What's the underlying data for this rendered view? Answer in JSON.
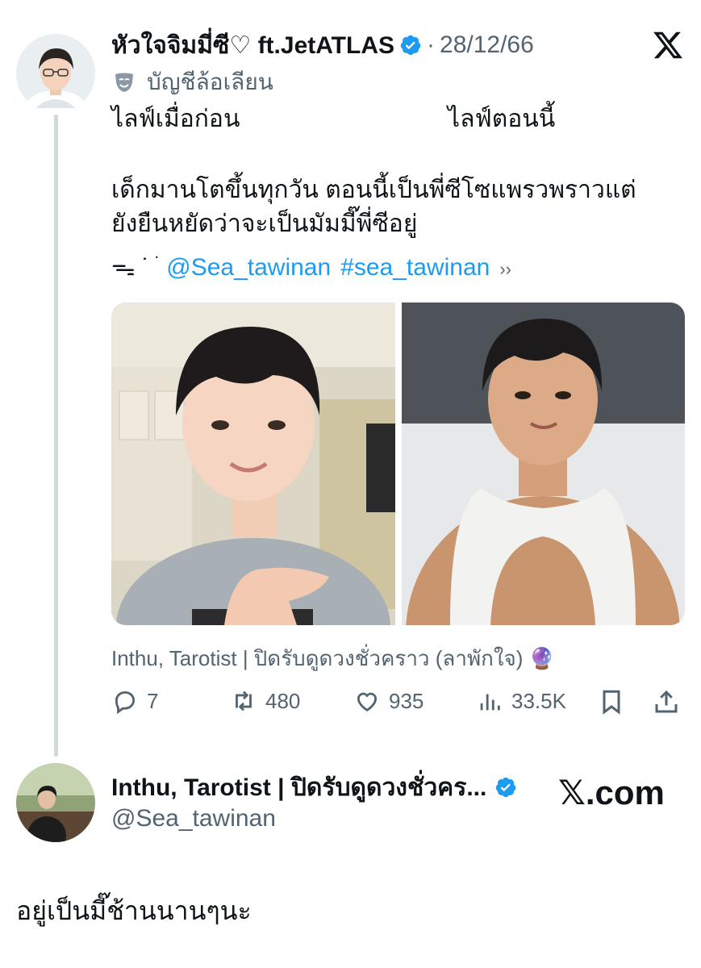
{
  "tweet": {
    "display_name": "หัวใจจิมมี่ซี♡ ft.JetATLAS",
    "separator": "·",
    "date": "28/12/66",
    "label_icon": "mask-icon",
    "label": "บัญชีล้อเลียน",
    "line1_left": "ไลฟ์เมื่อก่อน",
    "line1_right": "ไลฟ์ตอนนี้",
    "body_line1": "เด็กมานโตขึ้นทุกวัน ตอนนี้เป็นพี่ซีโซแพรวพราวแต่",
    "body_line2": "ยังยืนหยัดว่าจะเป็นมัมมี๊พี่ซีอยู่",
    "deco": "ᯓ ˙ ֹ",
    "mention": "@Sea_tawinan",
    "hashtag": "#sea_tawinan",
    "trail": "››",
    "quote_source": "Inthu, Tarotist | ปิดรับดูดวงชั่วคราว (ลาพักใจ) 🔮",
    "actions": {
      "replies": "7",
      "retweets": "480",
      "likes": "935",
      "views": "33.5K"
    }
  },
  "reply": {
    "display_name": "Inthu, Tarotist | ปิดรับดูดวงชั่วคร...",
    "handle": "@Sea_tawinan",
    "brand": "𝕏.com",
    "text": "อยู่เป็นมี๊ช้านนานๆนะ"
  },
  "colors": {
    "accent": "#1d9bf0",
    "muted": "#536471",
    "thread_line": "#cfd9de"
  }
}
